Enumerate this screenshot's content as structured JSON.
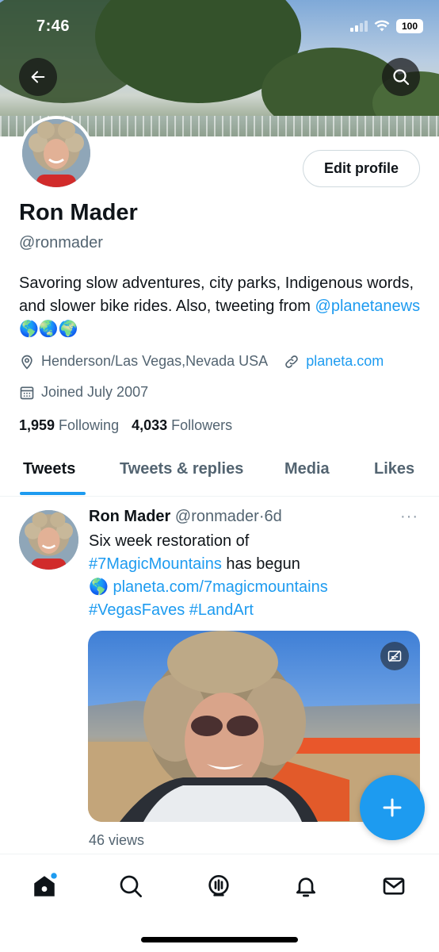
{
  "status_bar": {
    "time": "7:46",
    "battery": "100"
  },
  "profile": {
    "name": "Ron Mader",
    "handle": "@ronmader",
    "edit_label": "Edit profile",
    "bio_text": "Savoring slow adventures, city parks, Indigenous words, and slower bike rides. Also, tweeting from ",
    "bio_link": "@planetanews",
    "bio_emoji": "🌎🌏🌍",
    "location": "Henderson/Las Vegas,Nevada USA",
    "website": "planeta.com",
    "joined": "Joined July 2007",
    "following_count": "1,959",
    "following_label": "Following",
    "followers_count": "4,033",
    "followers_label": "Followers"
  },
  "tabs": [
    {
      "label": "Tweets",
      "active": true
    },
    {
      "label": "Tweets & replies",
      "active": false
    },
    {
      "label": "Media",
      "active": false
    },
    {
      "label": "Likes",
      "active": false
    }
  ],
  "tweet": {
    "author": "Ron Mader",
    "handle": "@ronmader",
    "separator": "·",
    "time": "6d",
    "more": "···",
    "line1": "Six week restoration of",
    "hashtag1": "#7MagicMountains",
    "line2_rest": " has begun",
    "emoji": "🌎",
    "url": "planeta.com/7magicmountains",
    "hashtag2": "#VegasFaves",
    "hashtag3": "#LandArt",
    "views": "46 views"
  },
  "icons": {
    "back": "arrow-left-icon",
    "search": "search-icon",
    "location": "map-pin-icon",
    "link": "link-icon",
    "calendar": "calendar-icon",
    "captions": "captions-icon",
    "compose": "plus-icon",
    "nav": [
      "home-icon",
      "search-icon",
      "spaces-icon",
      "notifications-icon",
      "messages-icon"
    ]
  },
  "colors": {
    "accent": "#1d9bf0",
    "text": "#0f1419",
    "secondary": "#536471"
  }
}
